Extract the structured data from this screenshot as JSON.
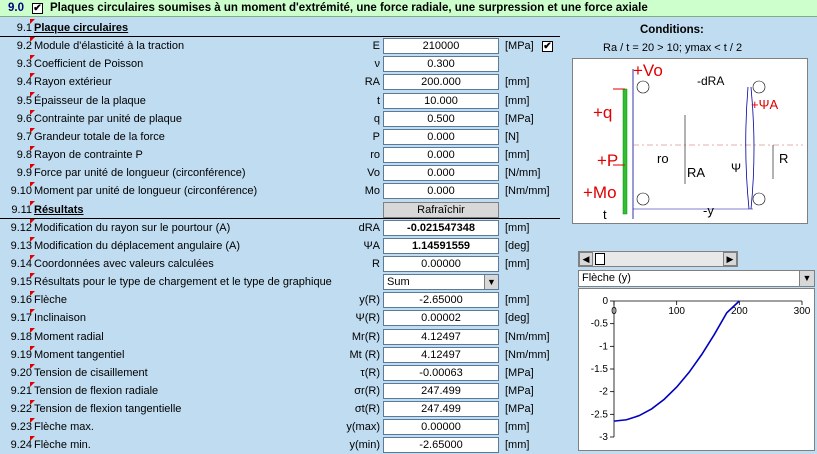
{
  "title": {
    "num": "9.0",
    "checked": "✔",
    "text": "Plaques circulaires soumises à un moment d'extrémité, une force radiale, une surpression et une force axiale"
  },
  "conditions": {
    "title": "Conditions:",
    "text": "Ra / t = 20 > 10;  ymax < t / 2",
    "checkbox": "✔"
  },
  "rows": [
    {
      "n": "9.1",
      "label": "Plaque circulaires",
      "sym": "",
      "val": "",
      "unit": "",
      "type": "sec"
    },
    {
      "n": "9.2",
      "label": "Module d'élasticité à la traction",
      "sym": "E",
      "val": "210000",
      "unit": "[MPa]",
      "type": "row"
    },
    {
      "n": "9.3",
      "label": "Coefficient de Poisson",
      "sym": "ν",
      "val": "0.300",
      "unit": "",
      "type": "row"
    },
    {
      "n": "9.4",
      "label": "Rayon extérieur",
      "sym": "RA",
      "val": "200.000",
      "unit": "[mm]",
      "type": "row"
    },
    {
      "n": "9.5",
      "label": "Épaisseur de la plaque",
      "sym": "t",
      "val": "10.000",
      "unit": "[mm]",
      "type": "row"
    },
    {
      "n": "9.6",
      "label": "Contrainte par unité de plaque",
      "sym": "q",
      "val": "0.500",
      "unit": "[MPa]",
      "type": "row"
    },
    {
      "n": "9.7",
      "label": "Grandeur totale de la force",
      "sym": "P",
      "val": "0.000",
      "unit": "[N]",
      "type": "row"
    },
    {
      "n": "9.8",
      "label": "Rayon de contrainte P",
      "sym": "ro",
      "val": "0.000",
      "unit": "[mm]",
      "type": "row"
    },
    {
      "n": "9.9",
      "label": "Force par unité de longueur (circonférence)",
      "sym": "Vo",
      "val": "0.000",
      "unit": "[N/mm]",
      "type": "row"
    },
    {
      "n": "9.10",
      "label": "Moment par unité de longueur (circonférence)",
      "sym": "Mo",
      "val": "0.000",
      "unit": "[Nm/mm]",
      "type": "row"
    },
    {
      "n": "9.11",
      "label": "Résultats",
      "sym": "",
      "val": "Rafraîchir",
      "unit": "",
      "type": "secbtn"
    },
    {
      "n": "9.12",
      "label": "Modification du rayon sur le pourtour (A)",
      "sym": "dRA",
      "val": "-0.021547348",
      "unit": "[mm]",
      "type": "bold"
    },
    {
      "n": "9.13",
      "label": "Modification du déplacement angulaire (A)",
      "sym": "ΨA",
      "val": "1.14591559",
      "unit": "[deg]",
      "type": "bold"
    },
    {
      "n": "9.14",
      "label": "Coordonnées avec valeurs calculées",
      "sym": "R",
      "val": "0.00000",
      "unit": "[mm]",
      "type": "row"
    },
    {
      "n": "9.15",
      "label": "Résultats pour le type de chargement et le type de graphique",
      "sym": "",
      "val": "Sum",
      "unit": "",
      "type": "dd"
    },
    {
      "n": "9.16",
      "label": "Flèche",
      "sym": "y(R)",
      "val": "-2.65000",
      "unit": "[mm]",
      "type": "row"
    },
    {
      "n": "9.17",
      "label": "Inclinaison",
      "sym": "Ψ(R)",
      "val": "0.00002",
      "unit": "[deg]",
      "type": "row"
    },
    {
      "n": "9.18",
      "label": "Moment radial",
      "sym": "Mr(R)",
      "val": "4.12497",
      "unit": "[Nm/mm]",
      "type": "row"
    },
    {
      "n": "9.19",
      "label": "Moment tangentiel",
      "sym": "Mt (R)",
      "val": "4.12497",
      "unit": "[Nm/mm]",
      "type": "row"
    },
    {
      "n": "9.20",
      "label": "Tension de cisaillement",
      "sym": "τ(R)",
      "val": "-0.00063",
      "unit": "[MPa]",
      "type": "row"
    },
    {
      "n": "9.21",
      "label": "Tension de flexion radiale",
      "sym": "σr(R)",
      "val": "247.499",
      "unit": "[MPa]",
      "type": "row"
    },
    {
      "n": "9.22",
      "label": "Tension de flexion tangentielle",
      "sym": "σt(R)",
      "val": "247.499",
      "unit": "[MPa]",
      "type": "row"
    },
    {
      "n": "9.23",
      "label": "Flèche max.",
      "sym": "y(max)",
      "val": "0.00000",
      "unit": "[mm]",
      "type": "row"
    },
    {
      "n": "9.24",
      "label": "Flèche min.",
      "sym": "y(min)",
      "val": "-2.65000",
      "unit": "[mm]",
      "type": "row"
    }
  ],
  "diagram": {
    "labels": [
      "+Vo",
      "-dRA",
      "+ΨA",
      "+q",
      "+P",
      "ro",
      "RA",
      "Ψ",
      "R",
      "+Mo",
      "t",
      "-y"
    ]
  },
  "graph_select": "Flèche (y)",
  "chart_data": {
    "type": "line",
    "xlim": [
      0,
      300
    ],
    "ylim": [
      -3,
      0
    ],
    "xticks": [
      "0",
      "100",
      "200",
      "300"
    ],
    "yticks": [
      "0",
      "-0.5",
      "-1",
      "-1.5",
      "-2",
      "-2.5",
      "-3"
    ],
    "x": [
      0,
      20,
      40,
      60,
      80,
      100,
      120,
      140,
      160,
      180,
      200
    ],
    "y": [
      -2.65,
      -2.62,
      -2.53,
      -2.38,
      -2.17,
      -1.9,
      -1.57,
      -1.18,
      -0.74,
      -0.26,
      0.0
    ],
    "color": "#0000c0"
  }
}
